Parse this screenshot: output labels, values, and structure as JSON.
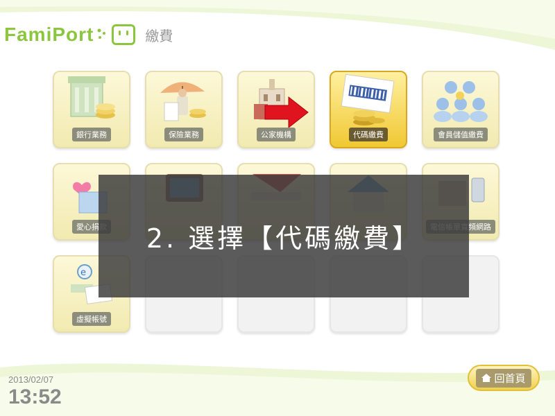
{
  "header": {
    "logo_text": "FamiPort",
    "page_title": "繳費"
  },
  "tiles": [
    {
      "label": "銀行業務",
      "icon": "bank-icon",
      "state": "normal"
    },
    {
      "label": "保險業務",
      "icon": "umbrella-icon",
      "state": "normal"
    },
    {
      "label": "公家機構",
      "icon": "government-building-icon",
      "state": "normal"
    },
    {
      "label": "代碼繳費",
      "icon": "barcode-coins-icon",
      "state": "selected"
    },
    {
      "label": "會員儲值繳費",
      "icon": "members-coins-icon",
      "state": "normal"
    },
    {
      "label": "愛心捐款",
      "icon": "heart-box-icon",
      "state": "normal"
    },
    {
      "label": "",
      "icon": "tv-icon",
      "state": "normal"
    },
    {
      "label": "",
      "icon": "etc-toll-icon",
      "state": "normal"
    },
    {
      "label": "",
      "icon": "house-icon",
      "state": "normal"
    },
    {
      "label": "電信帳單寬頻網路",
      "icon": "phone-bill-icon",
      "state": "normal"
    },
    {
      "label": "虛擬帳號",
      "icon": "virtual-account-icon",
      "state": "normal"
    }
  ],
  "overlay": {
    "instruction": "2. 選擇【代碼繳費】",
    "background": "#3c3c3c"
  },
  "footer": {
    "date": "2013/02/07",
    "time": "13:52",
    "home_label": "回首頁"
  },
  "colors": {
    "brand_green": "#8cc63f",
    "tile_yellow": "#f1eab0",
    "selected_yellow": "#f0c832",
    "arrow_red": "#e0141e"
  }
}
